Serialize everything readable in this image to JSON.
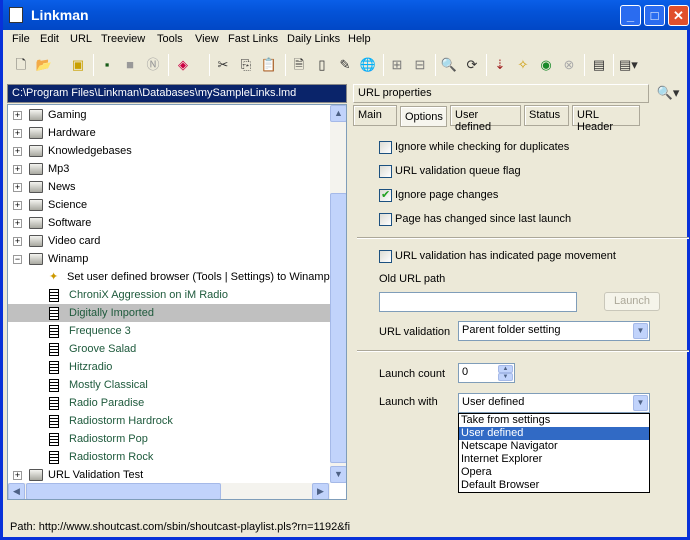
{
  "window": {
    "title": "Linkman"
  },
  "menu": [
    "File",
    "Edit",
    "URL",
    "Treeview",
    "Tools",
    "View",
    "Fast Links",
    "Daily Links",
    "Help"
  ],
  "path_bar": "C:\\Program Files\\Linkman\\Databases\\mySampleLinks.lmd",
  "tree": {
    "folders_top": [
      "Gaming",
      "Hardware",
      "Knowledgebases",
      "Mp3",
      "News",
      "Science",
      "Software",
      "Video card"
    ],
    "open_folder": "Winamp",
    "note": "Set user defined browser (Tools | Settings) to Winamp",
    "links": [
      "ChroniX Aggression on iM Radio",
      "Digitally Imported",
      "Frequence 3",
      "Groove Salad",
      "Hitzradio",
      "Mostly Classical",
      "Radio Paradise",
      "Radiostorm Hardrock",
      "Radiostorm Pop",
      "Radiostorm Rock"
    ],
    "selected": "Digitally Imported",
    "folders_bottom": [
      "URL Validation Test"
    ]
  },
  "status_bar": "Path: http://www.shoutcast.com/sbin/shoutcast-playlist.pls?rn=1192&fi",
  "panel": {
    "title": "URL properties",
    "tabs": [
      "Main",
      "Options",
      "User defined",
      "Status",
      "URL Header"
    ],
    "active_tab": "Options",
    "checkboxes": [
      {
        "label": "Ignore while checking for duplicates",
        "checked": false
      },
      {
        "label": "URL validation queue flag",
        "checked": false
      },
      {
        "label": "Ignore page changes",
        "checked": true
      },
      {
        "label": "Page has changed since last launch",
        "checked": false
      },
      {
        "label": "URL validation has indicated page movement",
        "checked": false
      }
    ],
    "old_url_label": "Old URL path",
    "old_url_value": "",
    "launch_button": "Launch",
    "url_validation_label": "URL validation",
    "url_validation_value": "Parent folder setting",
    "launch_count_label": "Launch count",
    "launch_count_value": "0",
    "launch_with_label": "Launch with",
    "launch_with_value": "User defined",
    "launch_with_options": [
      "Take from settings",
      "User defined",
      "Netscape Navigator",
      "Internet Explorer",
      "Opera",
      "Default Browser"
    ]
  }
}
